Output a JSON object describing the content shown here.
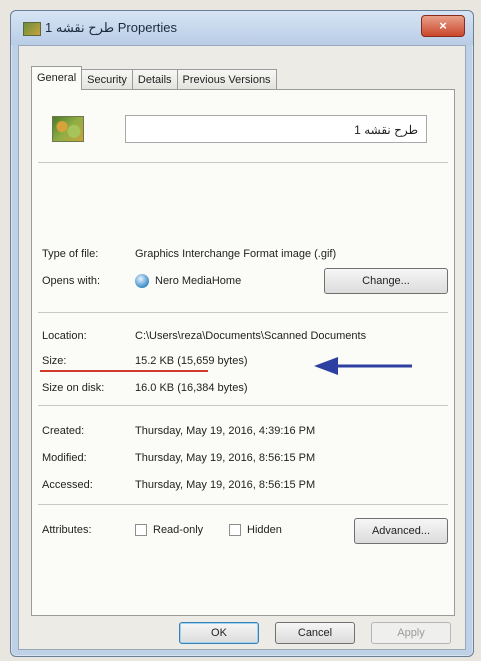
{
  "window": {
    "title": "طرح نقشه 1 Properties",
    "close_glyph": "×"
  },
  "tabs": [
    {
      "label": "General",
      "active": true
    },
    {
      "label": "Security",
      "active": false
    },
    {
      "label": "Details",
      "active": false
    },
    {
      "label": "Previous Versions",
      "active": false
    }
  ],
  "file": {
    "name": "طرح نقشه 1",
    "icon": "gif-image-icon"
  },
  "type_of_file": {
    "label": "Type of file:",
    "value": "Graphics Interchange Format image (.gif)"
  },
  "opens_with": {
    "label": "Opens with:",
    "value": "Nero MediaHome",
    "icon": "nero-mediahome-icon",
    "change_label": "Change..."
  },
  "location": {
    "label": "Location:",
    "value": "C:\\Users\\reza\\Documents\\Scanned Documents"
  },
  "size": {
    "label": "Size:",
    "value": "15.2 KB (15,659 bytes)"
  },
  "size_on_disk": {
    "label": "Size on disk:",
    "value": "16.0 KB (16,384 bytes)"
  },
  "created": {
    "label": "Created:",
    "value": "Thursday, May 19, 2016, 4:39:16 PM"
  },
  "modified": {
    "label": "Modified:",
    "value": "Thursday, May 19, 2016, 8:56:15 PM"
  },
  "accessed": {
    "label": "Accessed:",
    "value": "Thursday, May 19, 2016, 8:56:15 PM"
  },
  "attributes": {
    "label": "Attributes:",
    "readonly_label": "Read-only",
    "hidden_label": "Hidden",
    "readonly_checked": false,
    "hidden_checked": false,
    "advanced_label": "Advanced..."
  },
  "annotation": {
    "arrow_color": "#2d3fa0",
    "underline_color": "#d03a2a"
  },
  "buttons": {
    "ok": "OK",
    "cancel": "Cancel",
    "apply": "Apply"
  }
}
